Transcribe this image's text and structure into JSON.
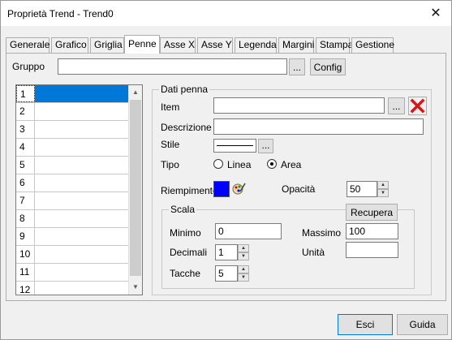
{
  "window": {
    "title": "Proprietà Trend - Trend0",
    "close_glyph": "✕"
  },
  "tabs": [
    {
      "label": "Generale"
    },
    {
      "label": "Grafico"
    },
    {
      "label": "Griglia"
    },
    {
      "label": "Penne"
    },
    {
      "label": "Asse X"
    },
    {
      "label": "Asse Y"
    },
    {
      "label": "Legenda"
    },
    {
      "label": "Margini"
    },
    {
      "label": "Stampa"
    },
    {
      "label": "Gestione"
    }
  ],
  "gruppo": {
    "label": "Gruppo",
    "value": "",
    "browse_label": "...",
    "config_label": "Config"
  },
  "pens_list": {
    "items": [
      "1",
      "2",
      "3",
      "4",
      "5",
      "6",
      "7",
      "8",
      "9",
      "10",
      "11",
      "12"
    ],
    "selected": "1"
  },
  "dati_penna": {
    "title": "Dati penna",
    "item_label": "Item",
    "item_value": "",
    "item_browse": "...",
    "delete_icon": "red-x-delete-icon",
    "descrizione_label": "Descrizione",
    "descrizione_value": "",
    "stile_label": "Stile",
    "stile_browse": "...",
    "tipo_label": "Tipo",
    "tipo_option_linea": "Linea",
    "tipo_option_area": "Area",
    "tipo_selected": "Area",
    "riempimento_label": "Riempimento",
    "fill_color": "#0000ff",
    "opacita_label": "Opacità",
    "opacita_value": "50"
  },
  "scala": {
    "title": "Scala",
    "recupera_label": "Recupera",
    "minimo_label": "Minimo",
    "minimo_value": "0",
    "massimo_label": "Massimo",
    "massimo_value": "100",
    "decimali_label": "Decimali",
    "decimali_value": "1",
    "unita_label": "Unità",
    "unita_value": "",
    "tacche_label": "Tacche",
    "tacche_value": "5"
  },
  "footer": {
    "esci_label": "Esci",
    "guida_label": "Guida"
  },
  "colors": {
    "accent": "#0078d7",
    "delete_red": "#d01a1a"
  }
}
